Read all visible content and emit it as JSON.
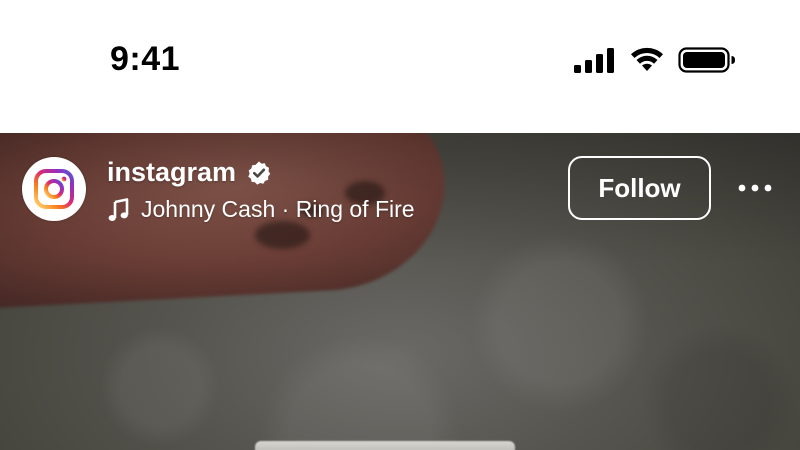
{
  "status_bar": {
    "time": "9:41",
    "icons": [
      "cellular-signal-icon",
      "wifi-icon",
      "battery-icon"
    ]
  },
  "reel_header": {
    "account": {
      "username": "instagram",
      "verified": true,
      "avatar_icon": "instagram-logo-icon"
    },
    "audio": {
      "icon": "music-note-icon",
      "label": "Johnny Cash · Ring of Fire"
    },
    "follow_label": "Follow",
    "more_icon": "more-horizontal-icon"
  },
  "colors": {
    "status_bar_bg": "#ffffff",
    "overlay_text": "#ffffff",
    "verified_badge": "#ffffff",
    "logo_gradient": [
      "#feda75",
      "#fa7e1e",
      "#d62976",
      "#962fbf",
      "#4f5bd5"
    ]
  }
}
